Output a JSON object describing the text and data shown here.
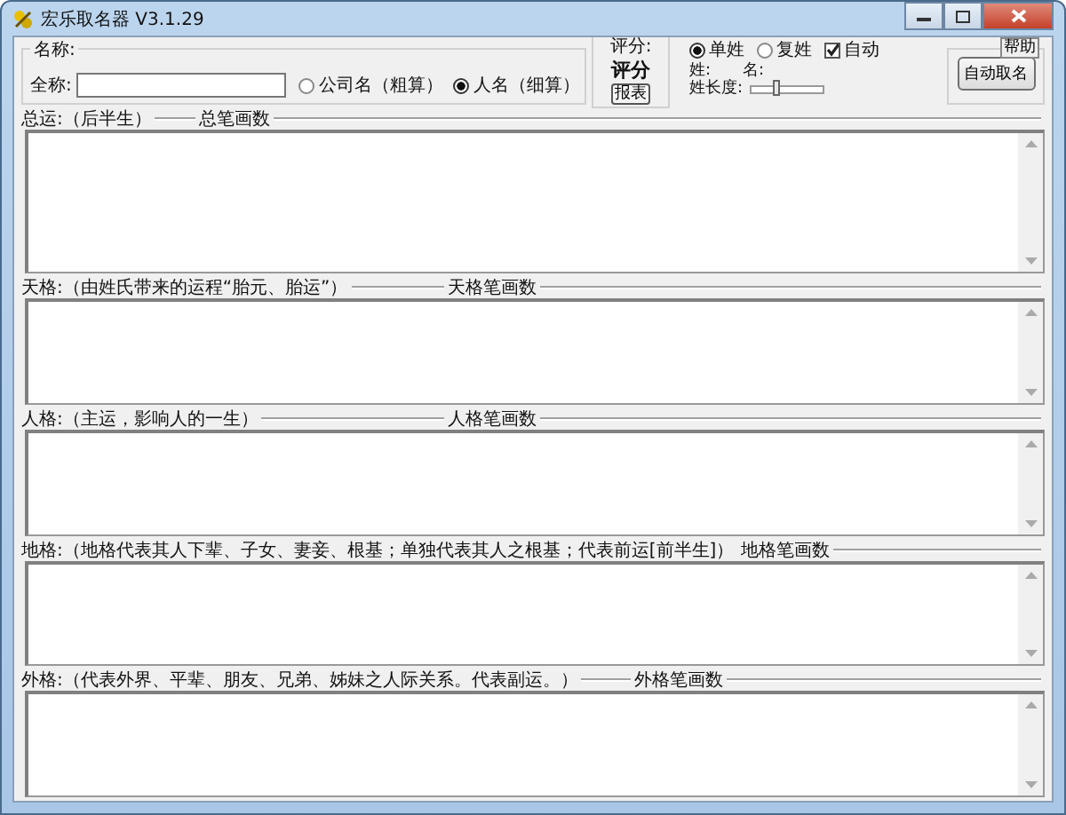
{
  "window": {
    "title": "宏乐取名器 V3.1.29"
  },
  "name_group": {
    "label": "名称:",
    "full_name_label": "全称:"
  },
  "name_type": [
    {
      "label": "公司名（粗算）",
      "selected": false
    },
    {
      "label": "人名（细算）",
      "selected": true
    }
  ],
  "score": {
    "label": "评分:",
    "value": "评分",
    "button": "报表"
  },
  "surname_type": [
    {
      "label": "单姓",
      "selected": true
    },
    {
      "label": "复姓",
      "selected": false
    }
  ],
  "auto": {
    "label": "自动",
    "checked": true
  },
  "surname_label": "姓:",
  "given_label": "名:",
  "surname_length": {
    "label": "姓长度:",
    "level": 0.35
  },
  "help": "帮助",
  "auto_name_button": "自动取名",
  "sections": [
    {
      "label": "总运:（后半生）",
      "strokes_label": "总笔画数"
    },
    {
      "label": "天格:（由姓氏带来的运程“胎元、胎运”）",
      "strokes_label": "天格笔画数"
    },
    {
      "label": "人格:（主运，影响人的一生）",
      "strokes_label": "人格笔画数"
    },
    {
      "label": "地格:（地格代表其人下辈、子女、妻妾、根基；单独代表其人之根基；代表前运[前半生]）",
      "strokes_label": "地格笔画数"
    },
    {
      "label": "外格:（代表外界、平辈、朋友、兄弟、姊妹之人际关系。代表副运。）",
      "strokes_label": "外格笔画数"
    }
  ]
}
